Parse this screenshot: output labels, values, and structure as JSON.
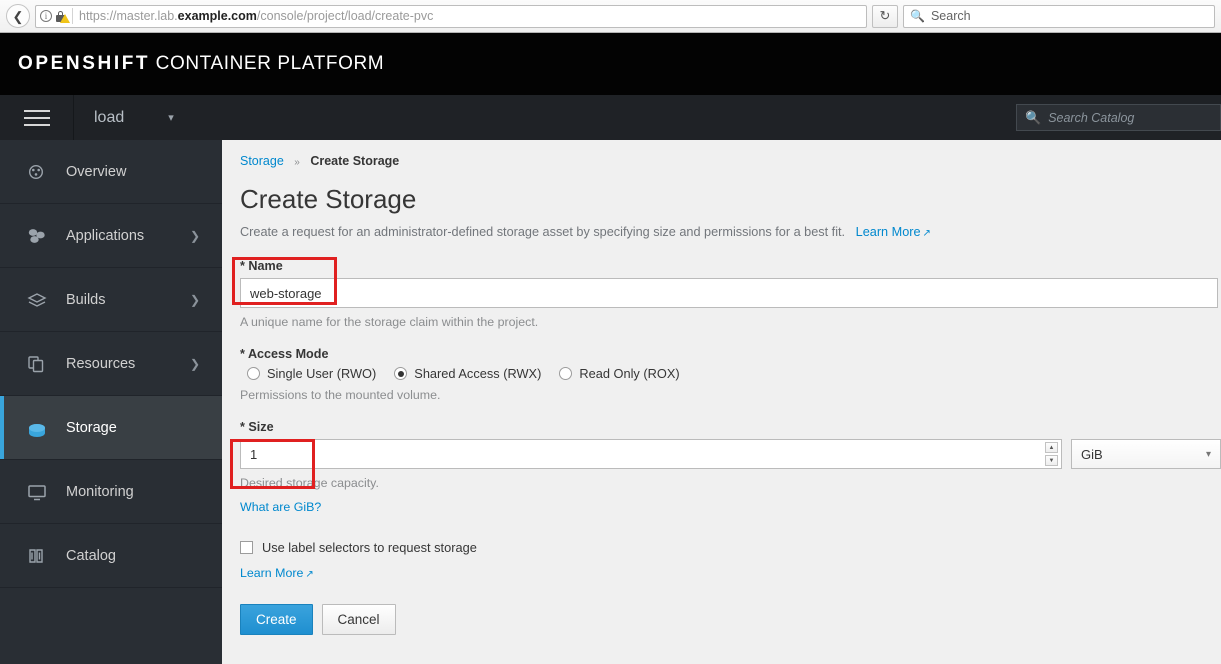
{
  "browser": {
    "back_icon": "back-arrow-icon",
    "info_icon": "info-icon",
    "lock_icon": "lock-warning-icon",
    "url_scheme": "https://master.lab.",
    "url_domain": "example.com",
    "url_path": "/console/project/load/create-pvc",
    "reload_icon": "reload-icon",
    "search_icon": "search-icon",
    "search_placeholder": "Search"
  },
  "masthead": {
    "brand_bold": "OPENSHIFT",
    "brand_light": "CONTAINER PLATFORM"
  },
  "subnav": {
    "menu_icon": "hamburger-menu-icon",
    "project_name": "load",
    "project_caret_icon": "chevron-down-icon",
    "catalog_search_icon": "search-icon",
    "catalog_search_placeholder": "Search Catalog"
  },
  "sidebar": {
    "items": [
      {
        "label": "Overview",
        "icon": "dashboard-icon",
        "has_chevron": false,
        "active": false
      },
      {
        "label": "Applications",
        "icon": "cubes-icon",
        "has_chevron": true,
        "active": false
      },
      {
        "label": "Builds",
        "icon": "layers-icon",
        "has_chevron": true,
        "active": false
      },
      {
        "label": "Resources",
        "icon": "files-icon",
        "has_chevron": true,
        "active": false
      },
      {
        "label": "Storage",
        "icon": "database-icon",
        "has_chevron": false,
        "active": true
      },
      {
        "label": "Monitoring",
        "icon": "monitor-icon",
        "has_chevron": false,
        "active": false
      },
      {
        "label": "Catalog",
        "icon": "book-icon",
        "has_chevron": false,
        "active": false
      }
    ]
  },
  "breadcrumb": {
    "parent": "Storage",
    "separator": "»",
    "current": "Create Storage"
  },
  "page": {
    "title": "Create Storage",
    "subtitle": "Create a request for an administrator-defined storage asset by specifying size and permissions for a best fit.",
    "subtitle_link": "Learn More",
    "external_icon": "external-link-icon"
  },
  "form": {
    "name": {
      "required_mark": "*",
      "label": "Name",
      "value": "web-storage",
      "placeholder": "",
      "help": "A unique name for the storage claim within the project."
    },
    "access_mode": {
      "required_mark": "*",
      "label": "Access Mode",
      "options": [
        {
          "label": "Single User (RWO)",
          "selected": false
        },
        {
          "label": "Shared Access (RWX)",
          "selected": true
        },
        {
          "label": "Read Only (ROX)",
          "selected": false
        }
      ],
      "help": "Permissions to the mounted volume."
    },
    "size": {
      "required_mark": "*",
      "label": "Size",
      "value": "1",
      "help": "Desired storage capacity.",
      "info_link": "What are GiB?",
      "unit_value": "GiB",
      "unit_caret_icon": "chevron-down-icon",
      "spinner_up_icon": "caret-up-icon",
      "spinner_down_icon": "caret-down-icon"
    },
    "label_selectors": {
      "label": "Use label selectors to request storage",
      "checked": false,
      "link": "Learn More",
      "external_icon": "external-link-icon"
    },
    "buttons": {
      "submit": "Create",
      "cancel": "Cancel"
    }
  },
  "annotations": {
    "accent_red": "#e02020",
    "accent_blue": "#0088ce"
  }
}
